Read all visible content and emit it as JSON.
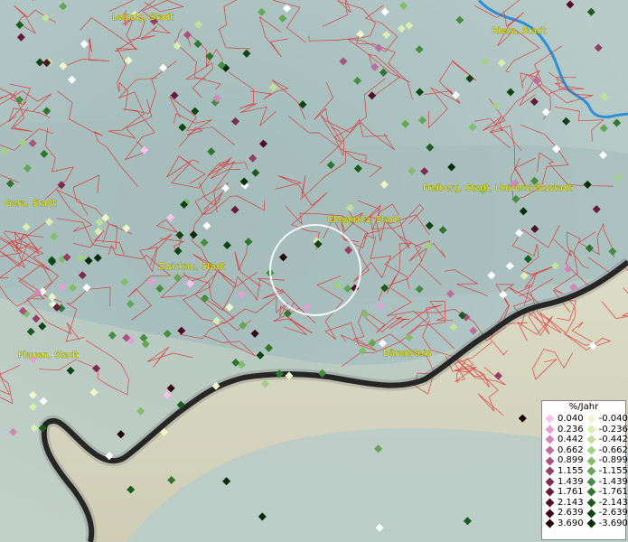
{
  "map": {
    "place_labels": [
      {
        "name": "Leipzig, Stadt"
      },
      {
        "name": "Riesa, Stadt"
      },
      {
        "name": "Gera, Stadt"
      },
      {
        "name": "Freiberg, Stadt, Universitätsstadt"
      },
      {
        "name": "Chemnitz, Stadt"
      },
      {
        "name": "Zwickau, Stadt"
      },
      {
        "name": "Plauen, Stadt"
      },
      {
        "name": "Bärenstein"
      }
    ]
  },
  "legend": {
    "title": "%/Jahr",
    "rows": [
      {
        "pos": "0.040",
        "pos_color": "#f7c3ee",
        "neg": "-0.040",
        "neg_color": "#eef7c9"
      },
      {
        "pos": "0.236",
        "pos_color": "#e3a0d4",
        "neg": "-0.236",
        "neg_color": "#d9eeb0"
      },
      {
        "pos": "0.442",
        "pos_color": "#d086b9",
        "neg": "-0.442",
        "neg_color": "#bfe19a"
      },
      {
        "pos": "0.662",
        "pos_color": "#bd6c9e",
        "neg": "-0.662",
        "neg_color": "#a2d184"
      },
      {
        "pos": "0.899",
        "pos_color": "#a85380",
        "neg": "-0.899",
        "neg_color": "#82bd6b"
      },
      {
        "pos": "1.155",
        "pos_color": "#933e66",
        "neg": "-1.155",
        "neg_color": "#63a653"
      },
      {
        "pos": "1.439",
        "pos_color": "#7d2b4e",
        "neg": "-1.439",
        "neg_color": "#468e3f"
      },
      {
        "pos": "1.761",
        "pos_color": "#661b39",
        "neg": "-1.761",
        "neg_color": "#2f762e"
      },
      {
        "pos": "2.143",
        "pos_color": "#500f26",
        "neg": "-2.143",
        "neg_color": "#1c5d1f"
      },
      {
        "pos": "2.639",
        "pos_color": "#3a0716",
        "neg": "-2.639",
        "neg_color": "#0f4513"
      },
      {
        "pos": "3.690",
        "pos_color": "#220008",
        "neg": "-3.690",
        "neg_color": "#052d08"
      }
    ]
  }
}
